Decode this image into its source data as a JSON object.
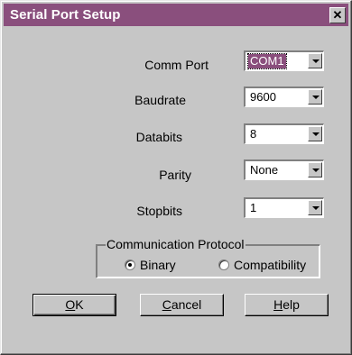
{
  "window": {
    "title": "Serial Port Setup",
    "close_glyph": "✕"
  },
  "fields": [
    {
      "label": "Comm Port",
      "value": "COM1"
    },
    {
      "label": "Baudrate",
      "value": "9600"
    },
    {
      "label": "Databits",
      "value": "8"
    },
    {
      "label": "Parity",
      "value": "None"
    },
    {
      "label": "Stopbits",
      "value": "1"
    }
  ],
  "protocol": {
    "title": "Communication Protocol",
    "options": [
      {
        "label": "Binary",
        "selected": true
      },
      {
        "label": "Compatibility",
        "selected": false
      }
    ]
  },
  "buttons": {
    "ok": {
      "first": "O",
      "rest": "K"
    },
    "cancel": {
      "first": "C",
      "rest": "ancel"
    },
    "help": {
      "first": "H",
      "rest": "elp"
    }
  },
  "colors": {
    "titlebar": "#8a4f7d",
    "face": "#c6c6c6"
  },
  "icons": {
    "close": "close-icon",
    "dropdown": "chevron-down-icon"
  }
}
